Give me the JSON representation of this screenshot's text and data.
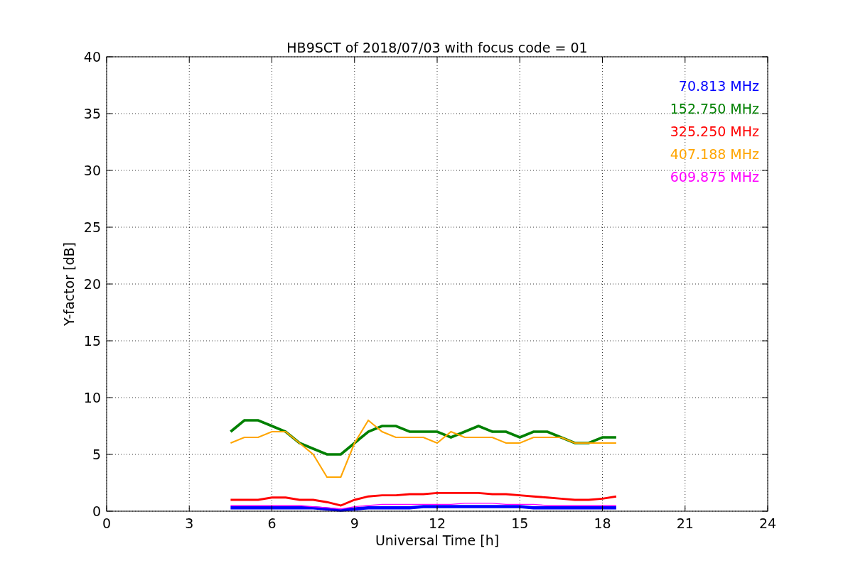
{
  "chart_data": {
    "type": "line",
    "grid": true,
    "title": "HB9SCT of 2018/07/03 with focus code = 01",
    "xlabel": "Universal Time [h]",
    "ylabel": "Y-factor [dB]",
    "xlim": [
      0,
      24
    ],
    "ylim": [
      0,
      40
    ],
    "xticks": [
      0,
      3,
      6,
      9,
      12,
      15,
      18,
      21,
      24
    ],
    "yticks": [
      0,
      5,
      10,
      15,
      20,
      25,
      30,
      35,
      40
    ],
    "x": [
      4.5,
      5,
      5.5,
      6,
      6.5,
      7,
      7.5,
      8,
      8.5,
      9,
      9.5,
      10,
      10.5,
      11,
      11.5,
      12,
      12.5,
      13,
      13.5,
      14,
      14.5,
      15,
      15.5,
      16,
      16.5,
      17,
      17.5,
      18,
      18.5
    ],
    "series": [
      {
        "name": "70.813 MHz",
        "color": "#0000ff",
        "values": [
          0.3,
          0.3,
          0.3,
          0.3,
          0.3,
          0.3,
          0.3,
          0.2,
          0.1,
          0.2,
          0.3,
          0.3,
          0.3,
          0.3,
          0.4,
          0.4,
          0.4,
          0.4,
          0.4,
          0.4,
          0.4,
          0.4,
          0.3,
          0.3,
          0.3,
          0.3,
          0.3,
          0.3,
          0.3
        ]
      },
      {
        "name": "152.750 MHz",
        "color": "#008000",
        "values": [
          7,
          8,
          8,
          7.5,
          7,
          6,
          5.5,
          5,
          5,
          6,
          7,
          7.5,
          7.5,
          7,
          7,
          7,
          6.5,
          7,
          7.5,
          7,
          7,
          6.5,
          7,
          7,
          6.5,
          6,
          6,
          6.5,
          6.5
        ]
      },
      {
        "name": "325.250 MHz",
        "color": "#ff0000",
        "values": [
          1,
          1,
          1,
          1.2,
          1.2,
          1,
          1,
          0.8,
          0.5,
          1,
          1.3,
          1.4,
          1.4,
          1.5,
          1.5,
          1.6,
          1.6,
          1.6,
          1.6,
          1.5,
          1.5,
          1.4,
          1.3,
          1.2,
          1.1,
          1,
          1,
          1.1,
          1.3
        ]
      },
      {
        "name": "407.188 MHz",
        "color": "#ffa500",
        "values": [
          6,
          6.5,
          6.5,
          7,
          7,
          6,
          5,
          3,
          3,
          6,
          8,
          7,
          6.5,
          6.5,
          6.5,
          6,
          7,
          6.5,
          6.5,
          6.5,
          6,
          6,
          6.5,
          6.5,
          6.5,
          6,
          6,
          6,
          6
        ]
      },
      {
        "name": "609.875 MHz",
        "color": "#ff00ff",
        "values": [
          0.5,
          0.5,
          0.5,
          0.5,
          0.5,
          0.5,
          0.4,
          0.3,
          0.2,
          0.4,
          0.5,
          0.6,
          0.6,
          0.6,
          0.6,
          0.6,
          0.6,
          0.7,
          0.7,
          0.7,
          0.6,
          0.6,
          0.6,
          0.5,
          0.5,
          0.5,
          0.5,
          0.5,
          0.5
        ]
      }
    ]
  }
}
